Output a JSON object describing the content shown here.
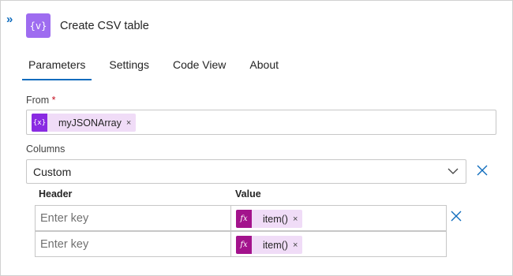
{
  "header": {
    "collapse_glyph": "»",
    "action_icon_glyph": "{v}",
    "title": "Create CSV table"
  },
  "tabs": [
    {
      "label": "Parameters",
      "active": true
    },
    {
      "label": "Settings",
      "active": false
    },
    {
      "label": "Code View",
      "active": false
    },
    {
      "label": "About",
      "active": false
    }
  ],
  "from": {
    "label": "From",
    "required_mark": "*",
    "token": {
      "icon": "variable-icon",
      "icon_glyph": "{x}",
      "text": "myJSONArray",
      "remove": "×"
    }
  },
  "columns": {
    "label": "Columns",
    "selected": "Custom"
  },
  "table": {
    "header_col": "Header",
    "value_col": "Value",
    "rows": [
      {
        "key_placeholder": "Enter key",
        "value_token": {
          "icon": "function-icon",
          "icon_glyph": "fx",
          "text": "item()",
          "remove": "×"
        }
      },
      {
        "key_placeholder": "Enter key",
        "value_token": {
          "icon": "function-icon",
          "icon_glyph": "fx",
          "text": "item()",
          "remove": "×"
        }
      }
    ]
  },
  "colors": {
    "accent": "#0f6cbd",
    "action_icon": "#9e6cf0",
    "token_bg": "#f0dcf7",
    "variable_icon": "#8a2be2",
    "function_icon": "#a3138c"
  }
}
